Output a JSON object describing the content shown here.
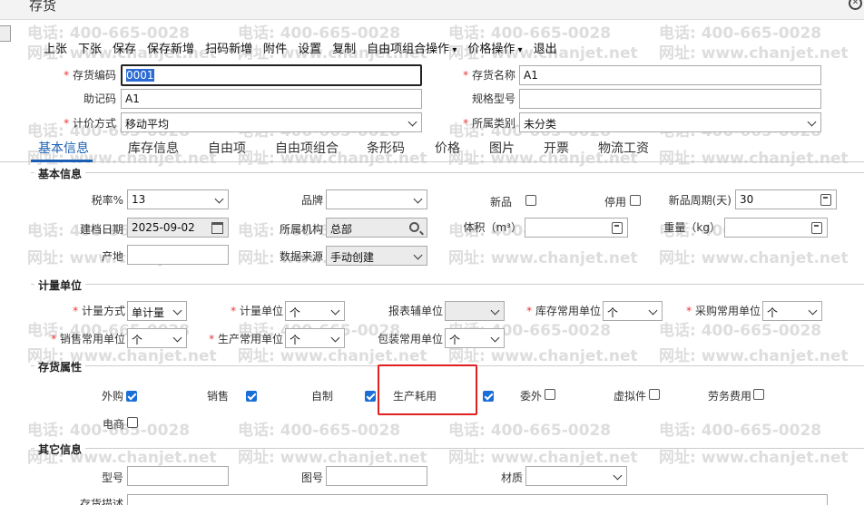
{
  "window": {
    "title": "存货"
  },
  "toolbar": {
    "items": [
      "上张",
      "下张",
      "保存",
      "保存新增",
      "扫码新增",
      "附件",
      "设置",
      "复制",
      "自由项组合操作",
      "价格操作",
      "退出"
    ]
  },
  "header": {
    "code_label": "存货编码",
    "code_value": "0001",
    "name_label": "存货名称",
    "name_value": "A1",
    "mnemonic_label": "助记码",
    "mnemonic_value": "A1",
    "spec_label": "规格型号",
    "spec_value": "",
    "pricing_label": "计价方式",
    "pricing_value": "移动平均",
    "category_label": "所属类别",
    "category_value": "未分类"
  },
  "tabs": [
    "基本信息",
    "库存信息",
    "自由项",
    "自由项组合",
    "条形码",
    "价格",
    "图片",
    "开票",
    "物流工资"
  ],
  "basic": {
    "section_title": "基本信息",
    "tax_label": "税率%",
    "tax_value": "13",
    "brand_label": "品牌",
    "brand_value": "",
    "new_label": "新品",
    "disabled_label": "停用",
    "newcycle_label": "新品周期(天)",
    "newcycle_value": "30",
    "created_label": "建档日期",
    "created_value": "2025-09-02",
    "org_label": "所属机构",
    "org_value": "总部",
    "volume_label": "体积（m³）",
    "volume_value": "",
    "weight_label": "重量（kg）",
    "weight_value": "",
    "origin_label": "产地",
    "origin_value": "",
    "source_label": "数据来源",
    "source_value": "手动创建"
  },
  "measure": {
    "section_title": "计量单位",
    "method_label": "计量方式",
    "method_value": "单计量",
    "unit_label": "计量单位",
    "unit_value": "个",
    "report_label": "报表辅单位",
    "report_value": "",
    "stock_label": "库存常用单位",
    "stock_value": "个",
    "purchase_label": "采购常用单位",
    "purchase_value": "个",
    "sales_label": "销售常用单位",
    "sales_value": "个",
    "production_label": "生产常用单位",
    "production_value": "个",
    "package_label": "包装常用单位",
    "package_value": "个"
  },
  "attributes": {
    "section_title": "存货属性",
    "items": [
      {
        "label": "外购",
        "checked": true
      },
      {
        "label": "销售",
        "checked": true
      },
      {
        "label": "自制",
        "checked": true
      },
      {
        "label": "生产耗用",
        "checked": true
      },
      {
        "label": "委外",
        "checked": false
      },
      {
        "label": "虚拟件",
        "checked": false
      },
      {
        "label": "劳务费用",
        "checked": false
      },
      {
        "label": "电商",
        "checked": false
      }
    ]
  },
  "other": {
    "section_title": "其它信息",
    "model_label": "型号",
    "model_value": "",
    "drawing_label": "图号",
    "drawing_value": "",
    "material_label": "材质",
    "material_value": "",
    "desc_label": "存货描述"
  },
  "watermark": {
    "phone": "电话: 400-665-0028",
    "site": "网址: www.chanjet.net"
  },
  "colors": {
    "accent": "#1a5fb4",
    "required": "#e33333",
    "highlight": "#e02020",
    "checkbox": "#1a6ed8"
  }
}
